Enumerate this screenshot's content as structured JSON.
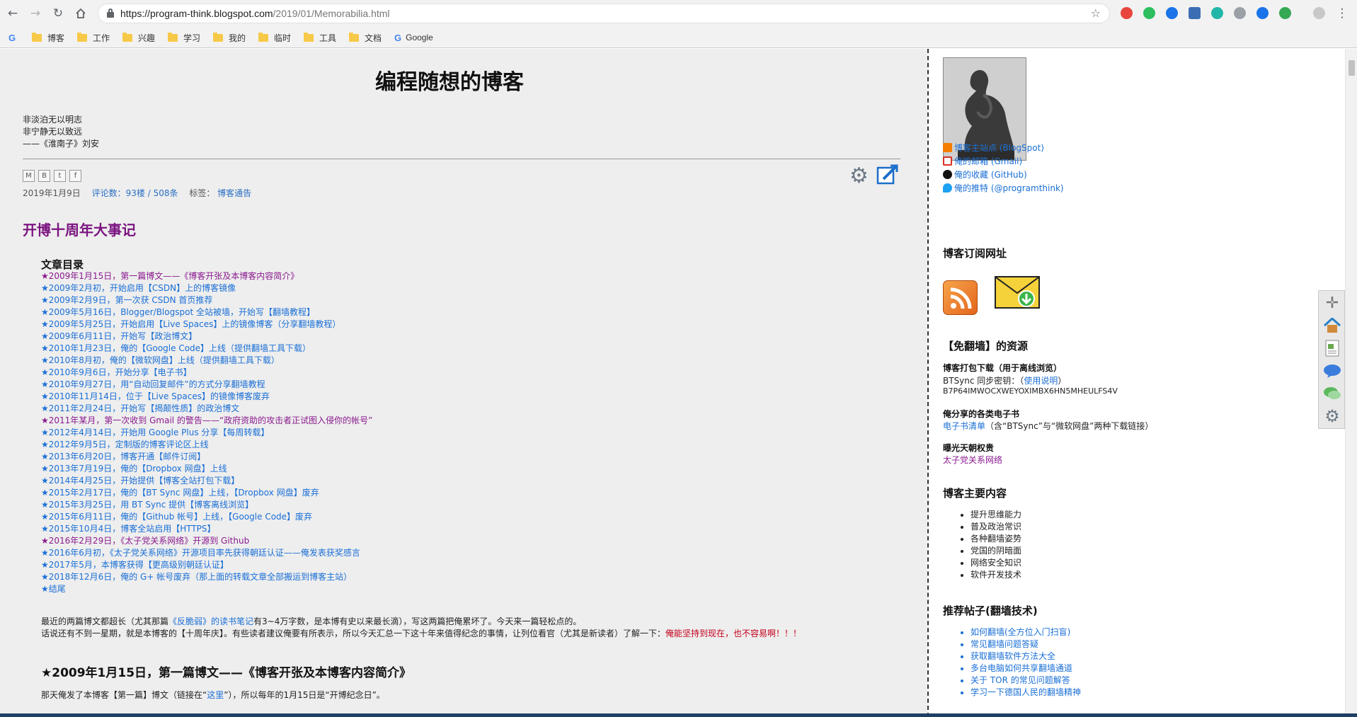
{
  "browser": {
    "url_host": "https://program-think.blogspot.com",
    "url_path": "/2019/01/Memorabilia.html",
    "bookmarks": [
      {
        "label": "博客"
      },
      {
        "label": "工作"
      },
      {
        "label": "兴趣"
      },
      {
        "label": "学习"
      },
      {
        "label": "我的"
      },
      {
        "label": "临时"
      },
      {
        "label": "工具"
      },
      {
        "label": "文档"
      },
      {
        "label": "Google"
      }
    ]
  },
  "main": {
    "blog_title": "编程随想的博客",
    "motto": [
      "非淡泊无以明志",
      "非宁静无以致远",
      "——《淮南子》刘安"
    ],
    "meta": {
      "date": "2019年1月9日",
      "comments": "评论数：93楼 / 508条",
      "tags_label": "标签：",
      "tag": "博客通告"
    },
    "post_title": "开博十周年大事记",
    "toc_heading": "文章目录",
    "toc": [
      "★2009年1月15日，第一篇博文——《博客开张及本博客内容简介》",
      "★2009年2月初，开始启用【CSDN】上的博客镜像",
      "★2009年2月9日，第一次获 CSDN 首页推荐",
      "★2009年5月16日，Blogger/Blogspot 全站被墙，开始写【翻墙教程】",
      "★2009年5月25日，开始启用【Live Spaces】上的镜像博客（分享翻墙教程）",
      "★2009年6月11日，开始写【政治博文】",
      "★2010年1月23日，俺的【Google Code】上线（提供翻墙工具下载）",
      "★2010年8月初，俺的【微软网盘】上线（提供翻墙工具下载）",
      "★2010年9月6日，开始分享【电子书】",
      "★2010年9月27日，用“自动回复邮件”的方式分享翻墙教程",
      "★2010年11月14日，位于【Live Spaces】的镜像博客废弃",
      "★2011年2月24日，开始写【揭颠性质】的政治博文",
      "★2011年某月，第一次收到 Gmail 的警告——“政府资助的攻击者正试图入侵你的帐号”",
      "★2012年4月14日，开始用 Google Plus 分享【每周转载】",
      "★2012年9月5日，定制版的博客评论区上线",
      "★2013年6月20日，博客开通【邮件订阅】",
      "★2013年7月19日，俺的【Dropbox 网盘】上线",
      "★2014年4月25日，开始提供【博客全站打包下载】",
      "★2015年2月17日，俺的【BT Sync 网盘】上线，【Dropbox 网盘】废弃",
      "★2015年3月25日，用 BT Sync 提供【博客离线浏览】",
      "★2015年6月11日，俺的【Github 帐号】上线，【Google Code】废弃",
      "★2015年10月4日，博客全站启用【HTTPS】",
      "★2016年2月29日，《太子党关系网络》开源到 Github",
      "★2016年6月初，《太子党关系网络》开源项目率先获得朝廷认证——俺发表获奖感言",
      "★2017年5月，本博客获得【更高级别朝廷认证】",
      "★2018年12月6日，俺的 G+ 帐号废弃（那上面的转载文章全部搬运到博客主站）",
      "★结尾"
    ],
    "intro_1a": "最近的两篇博文都超长（尤其那篇",
    "intro_1b": "《反脆弱》的读书笔记",
    "intro_1c": "有3~4万字数，是本博有史以来最长滴），写这两篇把俺累坏了。今天来一篇轻松点的。",
    "intro_2a": "话说还有不到一星期，就是本博客的【十周年庆】。有些读者建议俺要有所表示，所以今天汇总一下这十年来值得纪念的事情，让列位看官（尤其是新读者）了解一下：",
    "intro_2b": "俺能坚持到现在，也不容易啊！！！",
    "section_title": "★2009年1月15日，第一篇博文——《博客开张及本博客内容简介》",
    "section_text_a": "那天俺发了本博客【第一篇】博文（链接在“",
    "section_text_link": "这里",
    "section_text_b": "”），所以每年的1月15日是“开博纪念日”。"
  },
  "sidebar": {
    "links": [
      {
        "label": "博客主站点 (BlogSpot)",
        "icon": "blogger-icon",
        "color": "#f57d00"
      },
      {
        "label": "俺的邮箱 (Gmail)",
        "icon": "gmail-icon",
        "color": "#d93025"
      },
      {
        "label": "俺的收藏 (GitHub)",
        "icon": "github-icon",
        "color": "#111111"
      },
      {
        "label": "俺的推特 (@programthink)",
        "icon": "twitter-icon",
        "color": "#1da1f2"
      }
    ],
    "subscribe_heading": "博客订阅网址",
    "resources_heading": "【免翻墙】的资源",
    "offline_title": "博客打包下载（用于离线浏览）",
    "btsync_label": "BTSync 同步密钥：（",
    "btsync_link": "使用说明",
    "btsync_close": "）",
    "btsync_key": "B7P64IMWOCXWEYOXIMBX6HN5MHEULFS4V",
    "ebook_title": "俺分享的各类电子书",
    "ebook_link": "电子书清单",
    "ebook_note": "（含“BTSync”与“微软网盘”两种下载链接）",
    "expose_title": "曝光天朝权贵",
    "expose_link": "太子党关系网络",
    "main_heading": "博客主要内容",
    "main_items": [
      "提升思维能力",
      "普及政治常识",
      "各种翻墙姿势",
      "党国的阴暗面",
      "网络安全知识",
      "软件开发技术"
    ],
    "rec_heading": "推荐帖子(翻墙技术)",
    "rec_items": [
      "如何翻墙(全方位入门扫盲)",
      "常见翻墙问题答疑",
      "获取翻墙软件方法大全",
      "多台电脑如何共享翻墙通道",
      "关于 TOR 的常见问题解答",
      "学习一下德国人民的翻墙精神"
    ]
  }
}
